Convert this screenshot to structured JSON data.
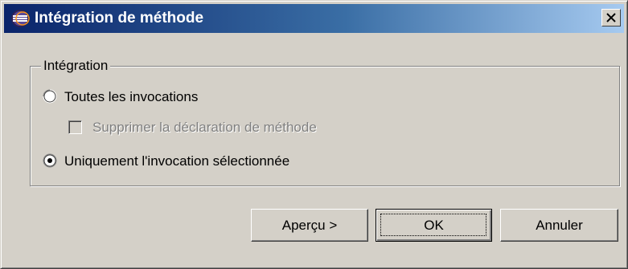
{
  "window": {
    "title": "Intégration de méthode",
    "app_icon": "eclipse-icon",
    "close_icon": "close-icon"
  },
  "group": {
    "legend": "Intégration",
    "options": [
      {
        "label": "Toutes les invocations",
        "selected": false
      },
      {
        "label": "Uniquement l'invocation sélectionnée",
        "selected": true
      }
    ],
    "checkbox": {
      "label": "Supprimer la déclaration de méthode",
      "checked": false,
      "enabled": false
    }
  },
  "buttons": {
    "preview": "Aperçu >",
    "ok": "OK",
    "cancel": "Annuler"
  },
  "colors": {
    "face": "#d4d0c8",
    "title_start": "#0a246a",
    "title_end": "#a6caf0"
  }
}
